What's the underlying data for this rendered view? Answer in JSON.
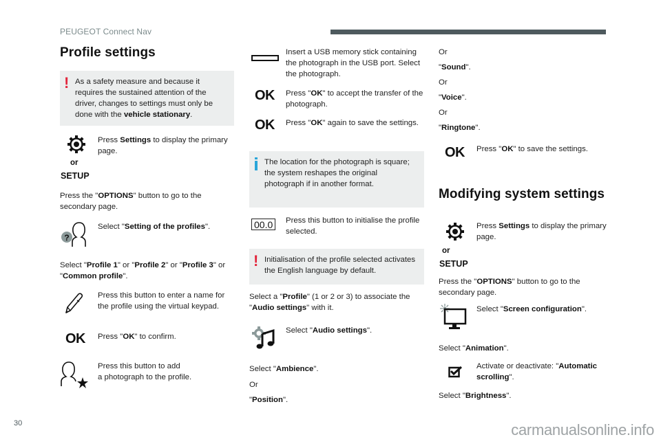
{
  "header": {
    "title": "PEUGEOT Connect Nav"
  },
  "footer": {
    "page_number": "30",
    "watermark": "carmanualsonline.info"
  },
  "colors": {
    "warning": "#e2253c",
    "info": "#2aa6d9",
    "note_bg": "#eceeee",
    "header_bar": "#4e5a5e"
  },
  "col1": {
    "title": "Profile settings",
    "warning_note": {
      "icon": "exclamation-icon",
      "text_before": "As a safety measure and because it requires the sustained attention of the driver, changes to settings must only be done with the ",
      "text_bold": "vehicle stationary",
      "text_after": "."
    },
    "settings_step": {
      "icon": "gear-icon",
      "or_label": "or",
      "setup_label": "SETUP",
      "pre": "Press ",
      "bold": "Settings",
      "post": " to display the primary page."
    },
    "options_step": {
      "pre": "Press the \"",
      "bold": "OPTIONS",
      "post": "\" button to go to the secondary page."
    },
    "profiles_step": {
      "icon": "profile-question-icon",
      "pre": "Select \"",
      "bold": "Setting of the profiles",
      "post": "\"."
    },
    "select_profile": {
      "t1": "Select \"",
      "b1": "Profile 1",
      "t2": "\" or \"",
      "b2": "Profile 2",
      "t3": "\" or \"",
      "b3": "Profile 3",
      "t4": "\" or \"",
      "b4": "Common profile",
      "t5": "\"."
    },
    "rename_step": {
      "icon": "pencil-icon",
      "text": "Press this button to enter a name for the profile using the virtual keypad."
    },
    "ok_step": {
      "icon_label": "OK",
      "pre": "Press \"",
      "bold": "OK",
      "post": "\" to confirm."
    },
    "photo_step": {
      "icon": "profile-star-icon",
      "line1": "Press this button to add",
      "line2": "a photograph to the profile."
    }
  },
  "col2": {
    "usb_step": {
      "icon": "usb-port-icon",
      "text": "Insert a USB memory stick containing the photograph in the USB port. Select the photograph."
    },
    "ok_accept": {
      "icon_label": "OK",
      "pre": "Press \"",
      "bold": "OK",
      "post": "\" to accept the transfer of the photograph."
    },
    "ok_save": {
      "icon_label": "OK",
      "pre": "Press \"",
      "bold": "OK",
      "post": "\" again to save the settings."
    },
    "info_note": {
      "icon": "info-icon",
      "text": "The location for the photograph is square; the system reshapes the original photograph if in another format."
    },
    "reset_step": {
      "icon_label": "00.0",
      "text": "Press this button to initialise the profile selected."
    },
    "warning_note": {
      "icon": "exclamation-icon",
      "text": "Initialisation of the profile selected activates the English language by default."
    },
    "associate": {
      "t1": "Select a \"",
      "b1": "Profile",
      "t2": "\" (1 or 2 or 3) to associate the \"",
      "b2": "Audio settings",
      "t3": "\" with it."
    },
    "audio_step": {
      "icon": "audio-settings-icon",
      "pre": "Select \"",
      "bold": "Audio settings",
      "post": "\"."
    },
    "ambience": {
      "pre": "Select \"",
      "bold": "Ambience",
      "post": "\"."
    },
    "or1": "Or",
    "position": {
      "pre": "\"",
      "bold": "Position",
      "post": "\"."
    }
  },
  "col3": {
    "or_a": "Or",
    "sound": {
      "pre": "\"",
      "bold": "Sound",
      "post": "\"."
    },
    "or_b": "Or",
    "voice": {
      "pre": "\"",
      "bold": "Voice",
      "post": "\"."
    },
    "or_c": "Or",
    "ringtone": {
      "pre": "\"",
      "bold": "Ringtone",
      "post": "\"."
    },
    "ok_save": {
      "icon_label": "OK",
      "pre": "Press \"",
      "bold": "OK",
      "post": "\" to save the settings."
    },
    "title": "Modifying system settings",
    "settings_step": {
      "icon": "gear-icon",
      "or_label": "or",
      "setup_label": "SETUP",
      "pre": "Press ",
      "bold": "Settings",
      "post": " to display the primary page."
    },
    "options_step": {
      "pre": "Press the \"",
      "bold": "OPTIONS",
      "post": "\" button to go to the secondary page."
    },
    "screen_step": {
      "icon": "screen-config-icon",
      "pre": "Select \"",
      "bold": "Screen configuration",
      "post": "\"."
    },
    "animation": {
      "pre": "Select \"",
      "bold": "Animation",
      "post": "\"."
    },
    "scroll_step": {
      "icon": "checkbox-icon",
      "pre": "Activate or deactivate: \"",
      "bold": "Automatic scrolling",
      "post": "\"."
    },
    "brightness": {
      "pre": "Select \"",
      "bold": "Brightness",
      "post": "\"."
    }
  }
}
